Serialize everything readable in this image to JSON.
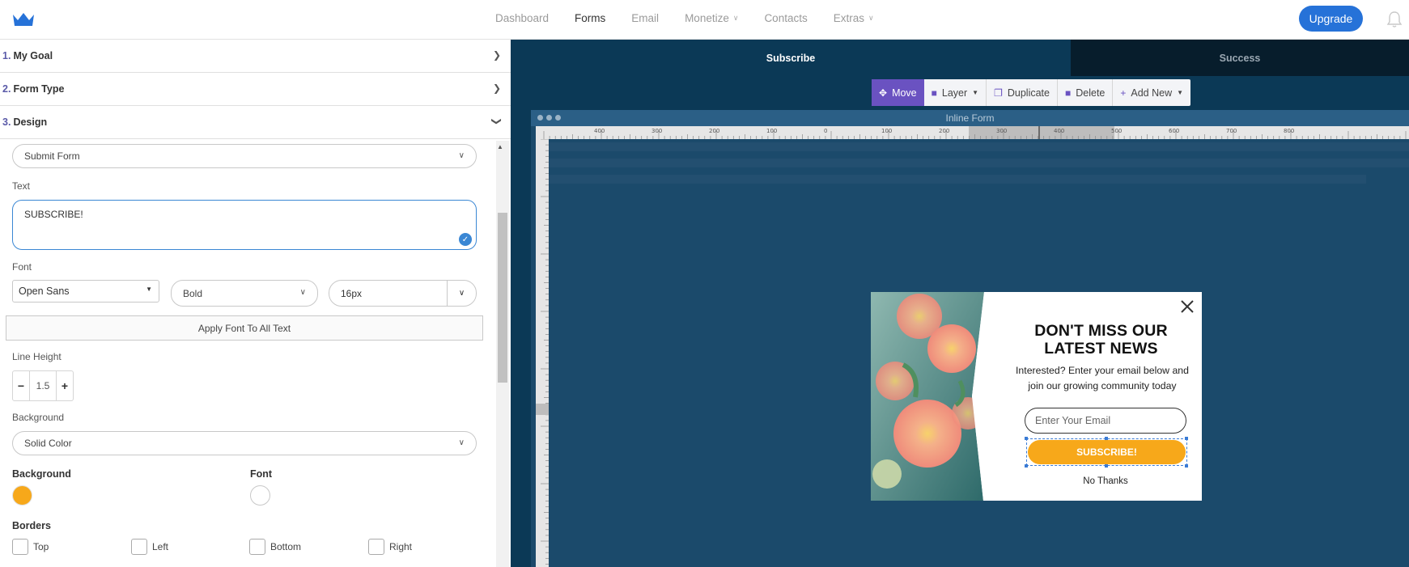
{
  "nav": {
    "items": [
      {
        "label": "Dashboard",
        "active": false,
        "dropdown": false
      },
      {
        "label": "Forms",
        "active": true,
        "dropdown": false
      },
      {
        "label": "Email",
        "active": false,
        "dropdown": false
      },
      {
        "label": "Monetize",
        "active": false,
        "dropdown": true
      },
      {
        "label": "Contacts",
        "active": false,
        "dropdown": false
      },
      {
        "label": "Extras",
        "active": false,
        "dropdown": true
      }
    ],
    "upgrade_label": "Upgrade",
    "brand_color": "#2672d8"
  },
  "sections": {
    "goal": {
      "num": "1.",
      "label": "My Goal"
    },
    "form_type": {
      "num": "2.",
      "label": "Form Type"
    },
    "design": {
      "num": "3.",
      "label": "Design"
    }
  },
  "design": {
    "element_select": "Submit Form",
    "text_label": "Text",
    "text_value": "SUBSCRIBE!",
    "font_label": "Font",
    "font_family": "Open Sans",
    "font_weight": "Bold",
    "font_size": "16px",
    "apply_font_label": "Apply Font To All Text",
    "line_height_label": "Line Height",
    "line_height_value": "1.5",
    "background_label": "Background",
    "background_type": "Solid Color",
    "colors": {
      "background_heading": "Background",
      "font_heading": "Font",
      "background_color": "#f7a81a",
      "font_color": "#ffffff"
    },
    "borders_label": "Borders",
    "borders": [
      {
        "label": "Top",
        "checked": false
      },
      {
        "label": "Left",
        "checked": false
      },
      {
        "label": "Bottom",
        "checked": false
      },
      {
        "label": "Right",
        "checked": false
      }
    ]
  },
  "editor": {
    "tabs": [
      {
        "label": "Subscribe",
        "active": true
      },
      {
        "label": "Success",
        "active": false
      }
    ],
    "toolbar": {
      "move": "Move",
      "layer": "Layer",
      "duplicate": "Duplicate",
      "delete": "Delete",
      "add_new": "Add New"
    },
    "frame_title": "Inline Form",
    "ruler_labels": [
      "400",
      "300",
      "200",
      "100",
      "0",
      "100",
      "200",
      "300",
      "400",
      "500",
      "600",
      "700",
      "800"
    ]
  },
  "popup": {
    "title": "DON'T MISS OUR LATEST NEWS",
    "text": "Interested? Enter your email below and join our growing community today",
    "email_placeholder": "Enter Your Email",
    "submit_label": "SUBSCRIBE!",
    "decline_label": "No Thanks",
    "accent_color": "#f7a81a"
  }
}
